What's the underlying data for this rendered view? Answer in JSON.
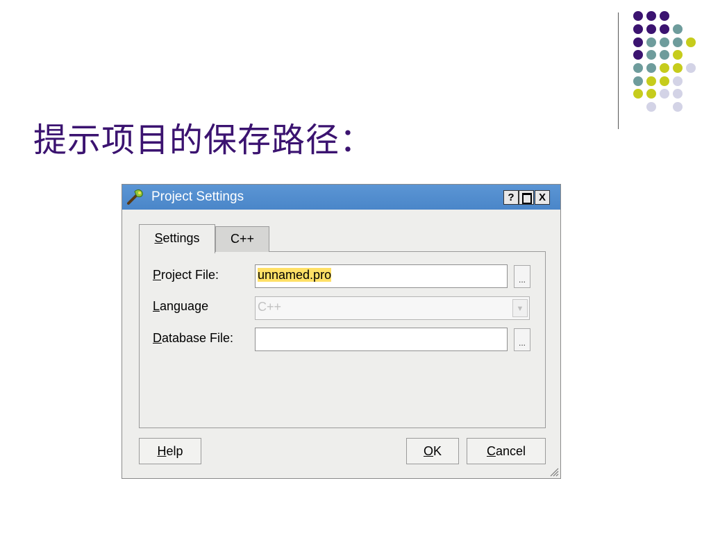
{
  "slide": {
    "title": "提示项目的保存路径："
  },
  "colors": {
    "title": "#3b1370",
    "dot_purple": "#3b1370",
    "dot_teal": "#6e9c9c",
    "dot_yellow": "#c6cc1c",
    "dot_lavender": "#d3d3e6",
    "titlebar": "#4a86c9",
    "selection": "#ffe066"
  },
  "dialog": {
    "title": "Project Settings",
    "icon": "wizard-wand-icon",
    "titlebar_buttons": {
      "help": "?",
      "maximize": "maximize-icon",
      "close": "X"
    },
    "tabs": [
      {
        "prefix": "",
        "accel": "S",
        "rest": "ettings",
        "active": true
      },
      {
        "prefix": "",
        "accel": "",
        "rest": "C++",
        "active": false
      }
    ],
    "form": {
      "project_file": {
        "accel": "P",
        "rest": "roject File:",
        "value": "unnamed.pro",
        "browse": "..."
      },
      "language": {
        "accel": "L",
        "rest": "anguage",
        "value": "C++",
        "disabled": true
      },
      "database_file": {
        "accel": "D",
        "rest": "atabase File:",
        "value": "",
        "browse": "..."
      }
    },
    "buttons": {
      "help": {
        "accel": "H",
        "rest": "elp"
      },
      "ok": {
        "accel": "O",
        "rest": "K"
      },
      "cancel": {
        "accel": "C",
        "rest": "ancel"
      }
    }
  }
}
